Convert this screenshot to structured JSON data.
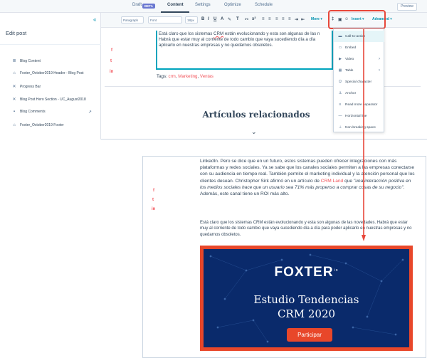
{
  "topnav": {
    "tabs": [
      "Draft",
      "Content",
      "Settings",
      "Optimize",
      "Schedule"
    ],
    "beta_badge": "BETA",
    "preview_button": "Preview"
  },
  "sidebar": {
    "title": "Edit post",
    "collapse_icon": "double-chevron-left-icon",
    "items": [
      {
        "label": "Blog Content",
        "icon": "content-icon"
      },
      {
        "label": "Foxter_October2019 Header - Blog Post",
        "icon": "header-module-icon"
      },
      {
        "label": "Progress Bar",
        "icon": "x-icon"
      },
      {
        "label": "Blog Post Hero Section - UC_August2018",
        "icon": "x-icon"
      },
      {
        "label": "Blog Comments",
        "icon": "comment-icon"
      },
      {
        "label": "Foxter_October2019 Footer",
        "icon": "footer-module-icon"
      }
    ]
  },
  "toolbar": {
    "paragraph_select": "Paragraph",
    "font_select": "Font",
    "size_select": "18px",
    "more_label": "More",
    "insert_label": "Insert",
    "advanced_label": "Advanced"
  },
  "insert_menu": {
    "items": [
      {
        "label": "Call-to-action",
        "icon": "cta-icon",
        "highlighted": true,
        "submenu": false
      },
      {
        "label": "Embed",
        "icon": "embed-icon",
        "submenu": false
      },
      {
        "label": "Video",
        "icon": "video-icon",
        "submenu": true
      },
      {
        "label": "Table",
        "icon": "table-icon",
        "submenu": true
      },
      {
        "label": "Special character",
        "icon": "omega-icon",
        "submenu": false
      },
      {
        "label": "Anchor",
        "icon": "anchor-icon",
        "submenu": false
      },
      {
        "label": "Read more separator",
        "icon": "read-more-icon",
        "submenu": false
      },
      {
        "label": "Horizontal line",
        "icon": "horizontal-line-icon",
        "submenu": false
      },
      {
        "label": "Non-breaking space",
        "icon": "nbsp-icon",
        "submenu": false
      }
    ]
  },
  "editor": {
    "paragraph_pre": "Está claro que los sistemas ",
    "paragraph_link": "CRM",
    "paragraph_mid": " están evolucionando y esta son algunas de las n",
    "paragraph_line2": "Habrá que estar muy al corriente de todo cambio que vaya sucediendo día a día",
    "paragraph_line3": "aplicarlo en nuestras empresas y no quedarnos obsoletos.",
    "tags_label": "Tags:",
    "tags": [
      "crm",
      "Marketing",
      "Ventas"
    ],
    "related_title": "Artículos relacionados",
    "social": [
      "f",
      "t",
      "in"
    ]
  },
  "preview": {
    "para1_a": "LinkedIn. Pero se dice que en un futuro, estos sistemas pueden ofrecer integraciones con más plataformas y redes sociales. Ya se sabe que los canales sociales permiten a las empresas conectarse con su audiencia en tiempo real. También permite el marketing individual y la atención personal que los clientes desean. Christopher Sirk afirmó en un artículo de ",
    "para1_link": "CRM Land",
    "para1_b": " que ",
    "para1_quote": "\"una interacción positiva en los medios sociales hace que un usuario sea 71% más propenso a comprar cosas de su negocio\"",
    "para1_c": ". Además, este canal tiene un ROI más alto.",
    "para2": "Está claro que los sistemas CRM están evolucionando y esta son algunas de las novedades. Habrá que estar muy al corriente de todo cambio que vaya sucediendo día a día para poder aplicarlo en nuestras empresas y no quedarnos obsoletos.",
    "banner": {
      "logo": "FOXTER",
      "logo_suffix": "io",
      "title_line1": "Estudio Tendencias",
      "title_line2": "CRM 2020",
      "button": "Participar"
    },
    "social": [
      "f",
      "t",
      "in"
    ]
  },
  "colors": {
    "accent_red": "#e8473a",
    "link": "#f2545b",
    "teal": "#00a4bd",
    "banner_bg": "#0a2a6b",
    "banner_orange": "#e8472a"
  }
}
